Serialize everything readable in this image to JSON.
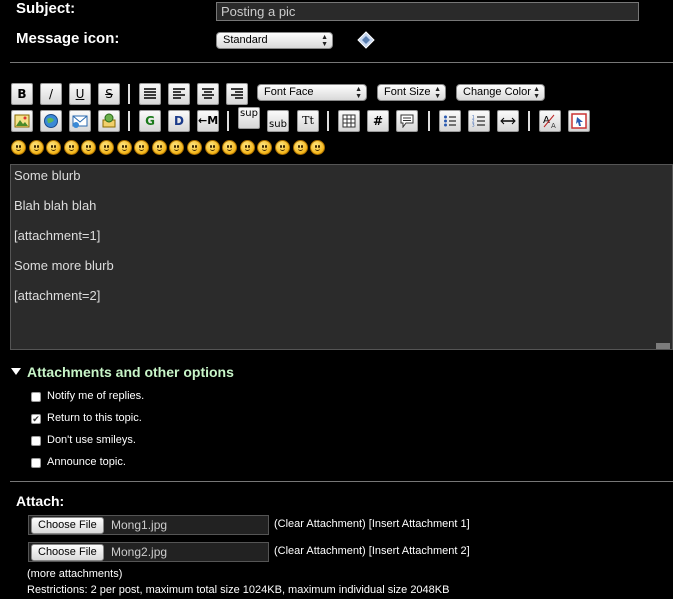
{
  "form": {
    "subject_label": "Subject:",
    "subject_value": "Posting a pic",
    "message_icon_label": "Message icon:",
    "message_icon_value": "Standard"
  },
  "toolbar": {
    "buttons_row1": [
      {
        "glyph": "B",
        "icon": "bold-icon"
      },
      {
        "glyph": "/",
        "icon": "italic-icon"
      },
      {
        "glyph": "U",
        "icon": "underline-icon"
      },
      {
        "glyph": "S",
        "icon": "strikethrough-icon"
      }
    ],
    "align_buttons": [
      "align-justify-icon",
      "align-left-icon",
      "align-center-icon",
      "align-right-icon"
    ],
    "font_face": "Font Face",
    "font_size": "Font Size",
    "change_color": "Change Color",
    "sup": "sup",
    "sub": "sub",
    "tt": "Tt",
    "hash": "#",
    "glow": "G",
    "shadow": "D",
    "move": "←M",
    "accent": "#1a7fd4"
  },
  "editor": {
    "lines": [
      "Some blurb",
      "Blah blah blah",
      "[attachment=1]",
      "Some more blurb",
      "[attachment=2]"
    ]
  },
  "options": {
    "header": "Attachments and other options",
    "items": [
      {
        "label": "Notify me of replies.",
        "checked": false
      },
      {
        "label": "Return to this topic.",
        "checked": true
      },
      {
        "label": "Don't use smileys.",
        "checked": false
      },
      {
        "label": "Announce topic.",
        "checked": false
      }
    ],
    "header_color": "#c8f5c8"
  },
  "attach": {
    "label": "Attach:",
    "choose_file": "Choose File",
    "files": [
      {
        "name": "Mong1.jpg",
        "links": "(Clear Attachment) [Insert Attachment 1]"
      },
      {
        "name": "Mong2.jpg",
        "links": "(Clear Attachment) [Insert Attachment 2]"
      }
    ],
    "more": "(more attachments)",
    "restrictions": "Restrictions: 2 per post, maximum total size 1024KB, maximum individual size 2048KB"
  }
}
